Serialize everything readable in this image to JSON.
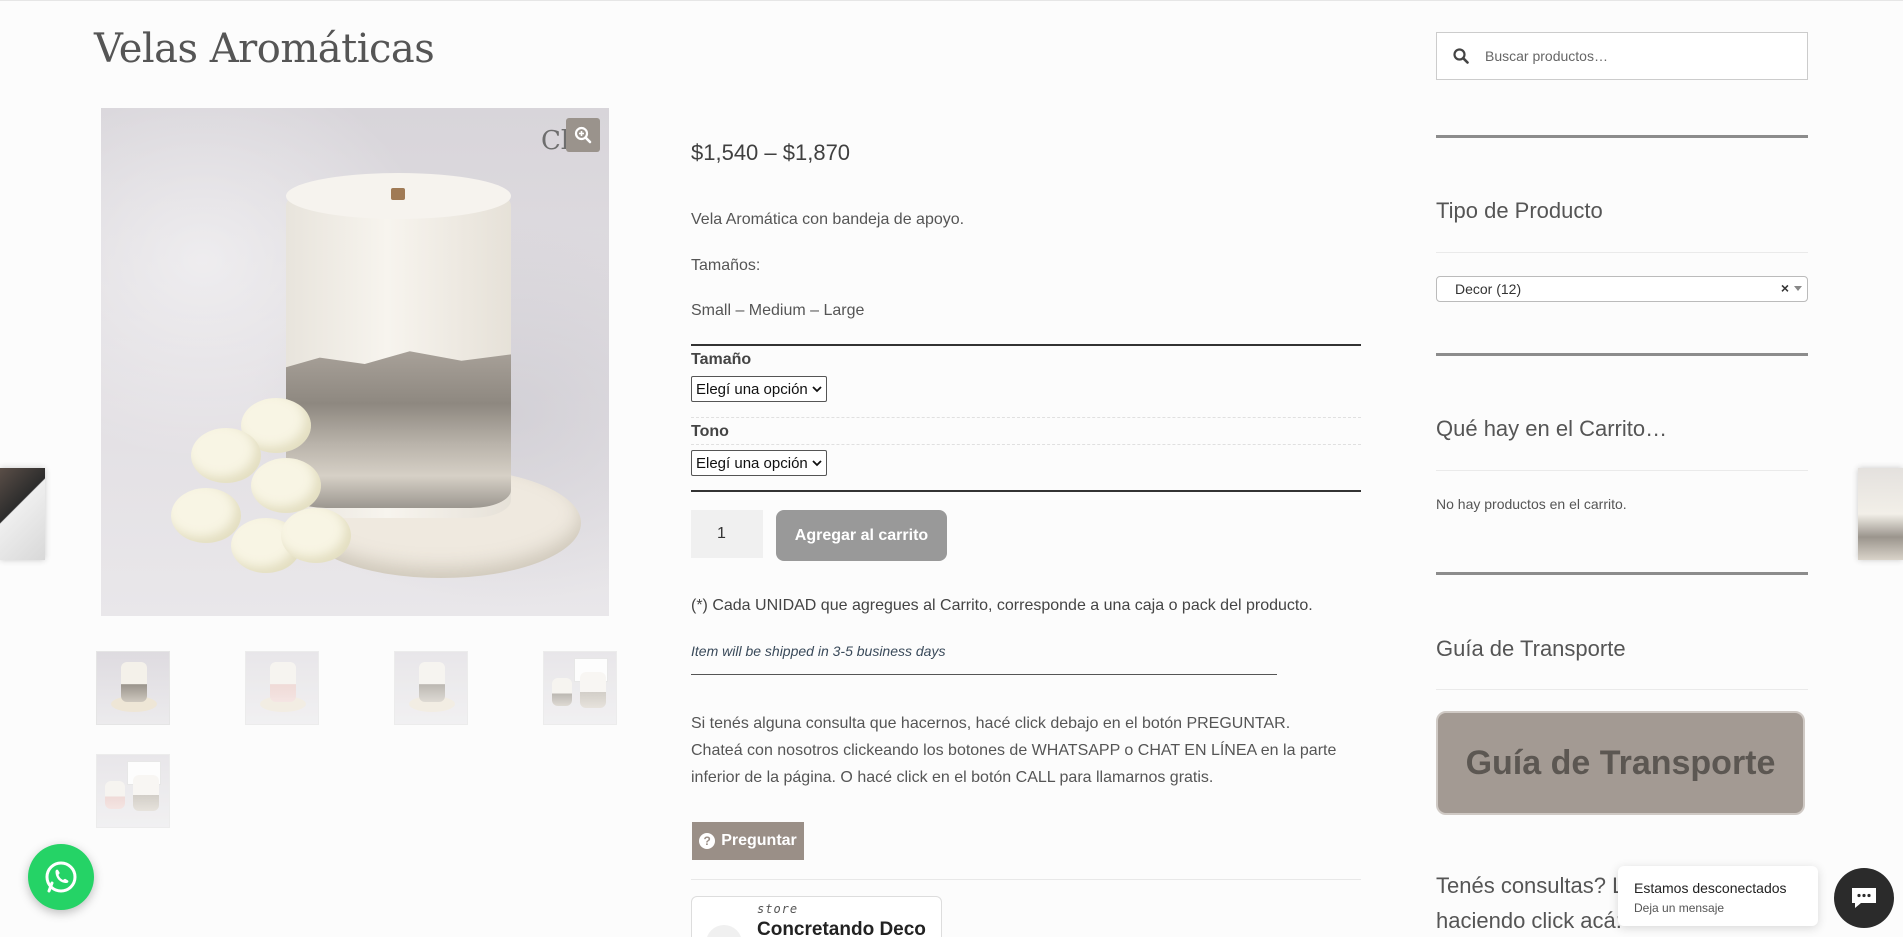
{
  "product": {
    "title": "Velas Aromáticas",
    "price": "$1,540 – $1,870",
    "description": "Vela Aromática con bandeja de apoyo.",
    "sizes_label": "Tamaños:",
    "sizes_list": "Small – Medium – Large",
    "image_brand_mark": "Cl"
  },
  "variations": {
    "size_label": "Tamaño",
    "size_selected": "Elegí una opción",
    "tone_label": "Tono",
    "tone_selected": "Elegí una opción"
  },
  "cart": {
    "quantity": "1",
    "add_button": "Agregar al carrito"
  },
  "notes": {
    "unit_note": "(*) Cada UNIDAD que agregues al Carrito, corresponde a una caja o pack del producto.",
    "shipping": "Item will be shipped in 3-5 business days",
    "consulta": "Si tenés alguna consulta que hacernos, hacé click debajo en el botón PREGUNTAR. Chateá con nosotros clickeando los botones de WHATSAPP o CHAT EN LÍNEA en la parte inferior de la página. O hacé click en el botón CALL para llamarnos gratis.",
    "ask_button": "Preguntar"
  },
  "store": {
    "label": "store",
    "name": "Concretando Deco"
  },
  "sidebar": {
    "search_placeholder": "Buscar productos…",
    "product_type_title": "Tipo de Producto",
    "product_type_selected": "Decor  (12)",
    "product_type_clear": "×",
    "cart_title": "Qué hay en el Carrito…",
    "cart_empty": "No hay productos en el carrito.",
    "transport_title": "Guía de Transporte",
    "transport_button": "Guía de Transporte",
    "consultas_line1": "Tenés consultas? L",
    "consultas_line2": "haciendo click acá:"
  },
  "chat": {
    "status": "Estamos desconectados",
    "sub": "Deja un mensaje"
  },
  "icons": {
    "zoom": "zoom-icon",
    "search": "search-icon",
    "whatsapp": "whatsapp-icon",
    "chat": "chat-icon",
    "question": "question-icon"
  },
  "colors": {
    "accent_taupe": "#9a8f87",
    "add_to_cart": "#999999",
    "whatsapp_green": "#25d366",
    "chat_dark": "#2b2b2b"
  }
}
